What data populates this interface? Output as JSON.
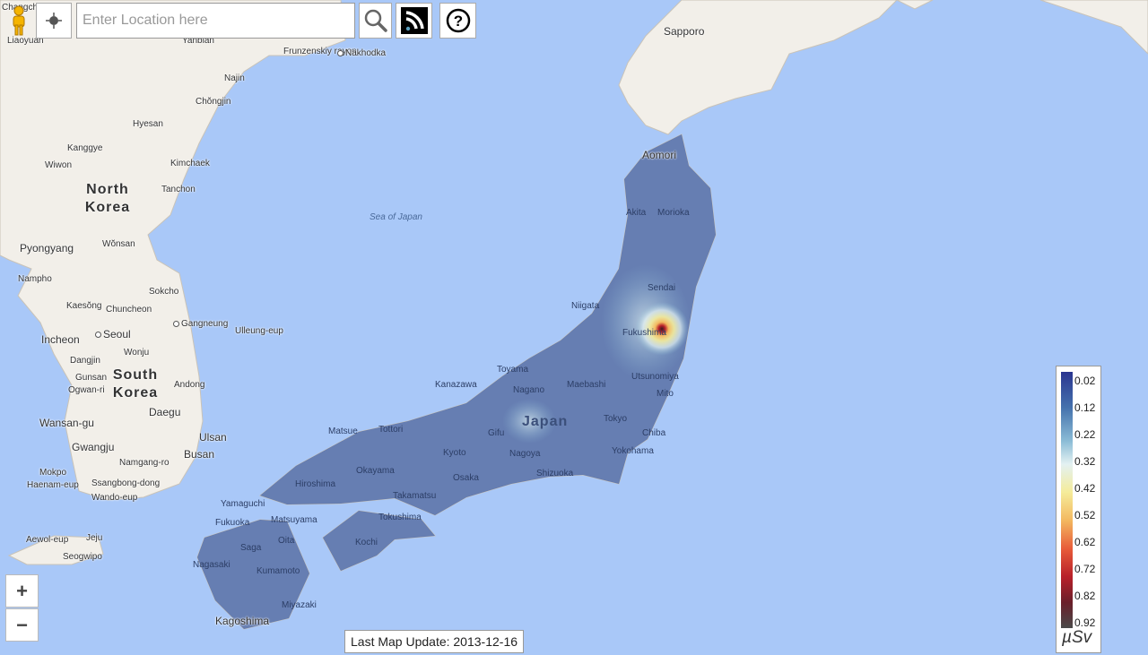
{
  "toolbar": {
    "search_placeholder": "Enter Location here",
    "icons": [
      "pegman-icon",
      "locate-icon",
      "search-icon",
      "rss-feed-icon",
      "help-icon"
    ]
  },
  "map": {
    "labels": {
      "changchun": "Changchun",
      "liaoyuan": "Liaoyuan",
      "yanbian": "Yanbian",
      "frunzenskiy": "Frunzenskiy rayon",
      "nakhodka": "Nakhodka",
      "najin": "Najin",
      "chongjin": "Chŏngjin",
      "hyesan": "Hyesan",
      "kanggye": "Kanggye",
      "wiwon": "Wiwon",
      "kimchaek": "Kimchaek",
      "tanchon": "Tanchon",
      "north_korea": "North Korea",
      "pyongyang": "Pyongyang",
      "wonsan": "Wŏnsan",
      "nampho": "Nampho",
      "kaesong": "Kaesŏng",
      "sokcho": "Sokcho",
      "chuncheon": "Chuncheon",
      "gangneung": "Gangneung",
      "ulleung": "Ulleung-eup",
      "incheon": "Incheon",
      "seoul": "Seoul",
      "wonju": "Wonju",
      "dangjin": "Dangjin",
      "gunsan": "Gunsan",
      "ogwan": "Ogwan-ri",
      "andong": "Andong",
      "south_korea": "South Korea",
      "daegu": "Daegu",
      "wansan": "Wansan-gu",
      "ulsan": "Ulsan",
      "gwangju": "Gwangju",
      "busan": "Busan",
      "namgang": "Namgang-ro",
      "mokpo": "Mokpo",
      "haenam": "Haenam-eup",
      "ssangbong": "Ssangbong-dong",
      "wando": "Wando-eup",
      "aewol": "Aewol-eup",
      "jeju": "Jeju",
      "seogwipo": "Seogwipo",
      "sea_of_japan": "Sea of Japan",
      "sapporo": "Sapporo",
      "aomori": "Aomori",
      "akita": "Akita",
      "morioka": "Morioka",
      "sendai": "Sendai",
      "niigata": "Niigata",
      "fukushima": "Fukushima",
      "toyama": "Toyama",
      "kanazawa": "Kanazawa",
      "nagano": "Nagano",
      "maebashi": "Maebashi",
      "utsunomiya": "Utsunomiya",
      "mito": "Mito",
      "japan": "Japan",
      "tokyo": "Tokyo",
      "chiba": "Chiba",
      "yokohama": "Yokohama",
      "shizuoka": "Shizuoka",
      "nagoya": "Nagoya",
      "gifu": "Gifu",
      "kyoto": "Kyoto",
      "osaka": "Osaka",
      "matsue": "Matsue",
      "tottori": "Tottori",
      "okayama": "Okayama",
      "hiroshima": "Hiroshima",
      "takamatsu": "Takamatsu",
      "tokushima": "Tokushima",
      "kochi": "Kochi",
      "matsuyama": "Matsuyama",
      "yamaguchi": "Yamaguchi",
      "fukuoka": "Fukuoka",
      "oita": "Oita",
      "saga": "Saga",
      "nagasaki": "Nagasaki",
      "kumamoto": "Kumamoto",
      "miyazaki": "Miyazaki",
      "kagoshima": "Kagoshima"
    },
    "colors": {
      "water": "#a9c8f8",
      "land": "#f2efe9",
      "overlay": "#4e6aa8"
    }
  },
  "zoom_controls": {
    "zoom_in": "+",
    "zoom_out": "−"
  },
  "legend": {
    "ticks": [
      "0.02",
      "0.12",
      "0.22",
      "0.32",
      "0.42",
      "0.52",
      "0.62",
      "0.72",
      "0.82",
      "0.92"
    ],
    "unit": "µSv",
    "colors": [
      "#2a3590",
      "#4572ad",
      "#8bbcd6",
      "#e3f1f2",
      "#f5ec9a",
      "#f3b860",
      "#e85c3a",
      "#b8202a",
      "#6a1f2a",
      "#4a4a4a"
    ]
  },
  "status": {
    "last_update": "Last Map Update: 2013-12-16"
  }
}
